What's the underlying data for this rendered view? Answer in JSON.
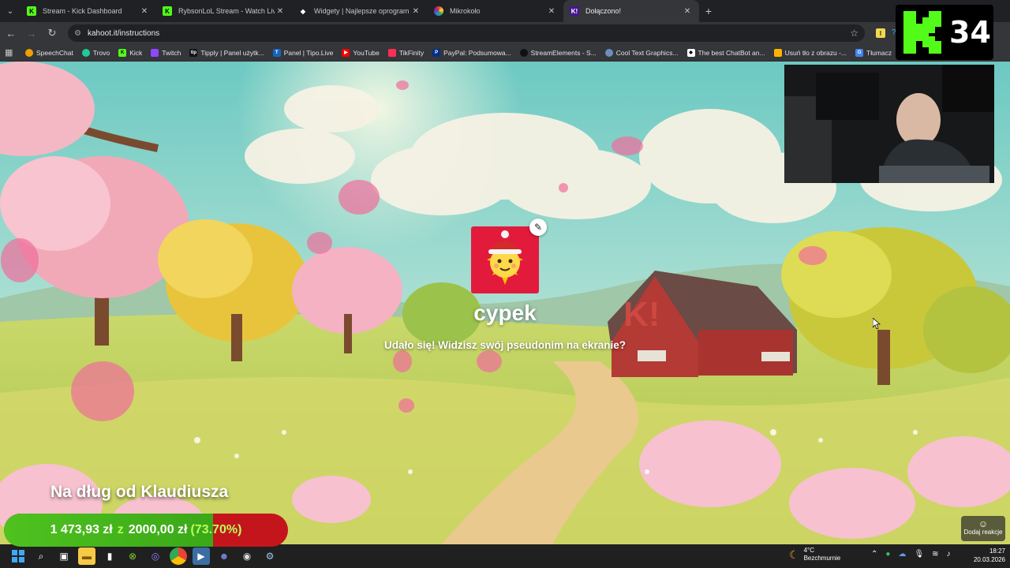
{
  "browser": {
    "tabs": [
      {
        "title": "Stream - Kick Dashboard",
        "icon": "kick-icon",
        "color": "#53fc18"
      },
      {
        "title": "RybsonLoL Stream - Watch Live",
        "icon": "kick-icon",
        "color": "#53fc18"
      },
      {
        "title": "Widgety | Najlepsze oprogram",
        "icon": "diamond-icon",
        "color": "#ffffff"
      },
      {
        "title": "Mikrokoło",
        "icon": "wheel-icon",
        "color": "#e040fb"
      },
      {
        "title": "Dołączono!",
        "icon": "kahoot-icon",
        "color": "#46178f",
        "active": true
      }
    ],
    "url": "kahoot.it/instructions",
    "bookmarks": [
      {
        "label": "SpeechChat",
        "color": "#f29f05"
      },
      {
        "label": "Trovo",
        "color": "#1ecd96"
      },
      {
        "label": "Kick",
        "color": "#53fc18"
      },
      {
        "label": "Twitch",
        "color": "#9146ff"
      },
      {
        "label": "Tipply | Panel użytk...",
        "color": "#111111"
      },
      {
        "label": "Panel | Tipo.Live",
        "color": "#1565c0"
      },
      {
        "label": "YouTube",
        "color": "#ff0000"
      },
      {
        "label": "TikFinity",
        "color": "#ff2d55"
      },
      {
        "label": "PayPal: Podsumowa...",
        "color": "#003087"
      },
      {
        "label": "StreamElements - S...",
        "color": "#111111"
      },
      {
        "label": "Cool Text Graphics...",
        "color": "#6c8ebf"
      },
      {
        "label": "The best ChatBot an...",
        "color": "#111111"
      },
      {
        "label": "Usuń tło z obrazu -...",
        "color": "#ffb300"
      },
      {
        "label": "Tłumacz",
        "color": "#4285f4"
      }
    ]
  },
  "kahoot": {
    "nickname": "cypek",
    "message": "Udało się! Widzisz swój pseudonim na ekranie?"
  },
  "overlay": {
    "viewer_count": "34",
    "goal_title": "Na dług od Klaudiusza",
    "goal_current": "1 473,93 zł",
    "goal_separator": "z",
    "goal_target": "2000,00 zł",
    "goal_percent_label": "(73.70%)",
    "goal_progress": 0.737,
    "react_label": "Dodaj reakcje"
  },
  "taskbar": {
    "temperature": "4°C",
    "weather": "Bezchmurnie",
    "time": "18:27",
    "date": "20.03.2026"
  },
  "colors": {
    "kick_green": "#53fc18",
    "kahoot_red": "#e21b3c",
    "goal_red": "#c4151c",
    "goal_green": "#4fc21f"
  }
}
